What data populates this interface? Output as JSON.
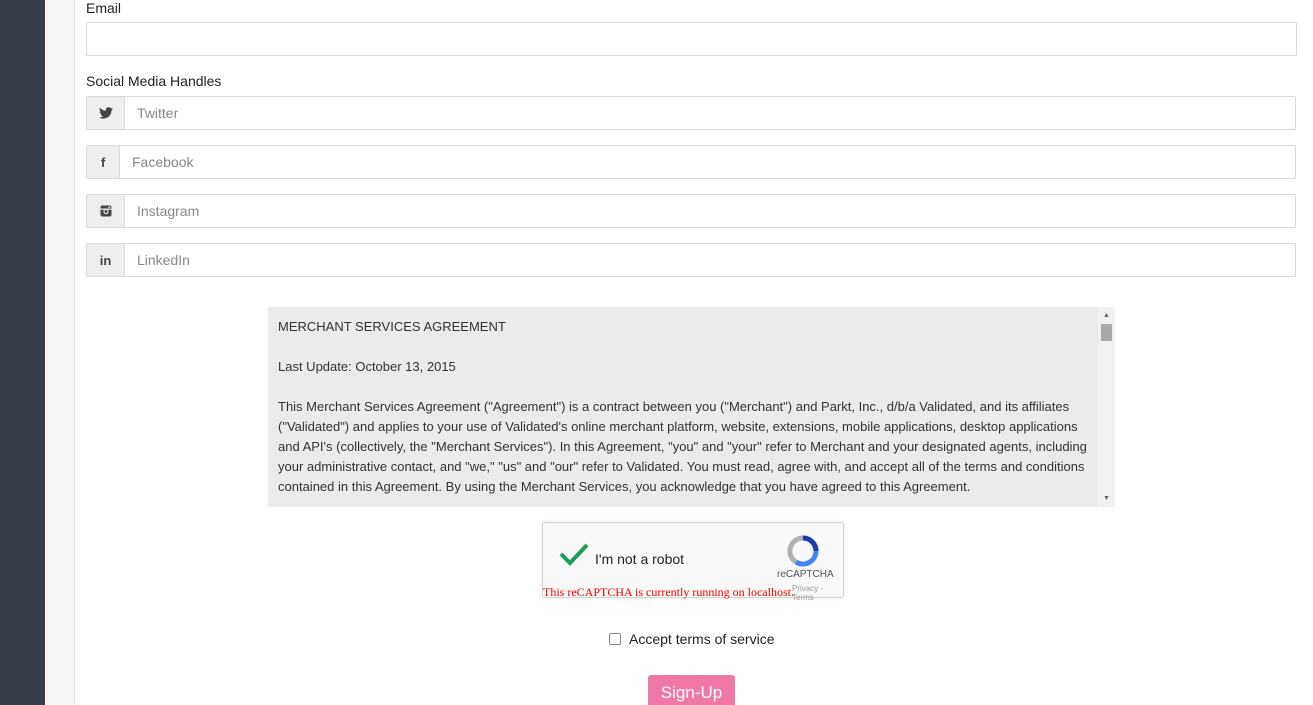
{
  "form": {
    "email_label": "Email",
    "email_value": "",
    "social_label": "Social Media Handles",
    "social": [
      {
        "icon": "twitter-icon",
        "glyph": "🐦",
        "placeholder": "Twitter"
      },
      {
        "icon": "facebook-icon",
        "glyph": "f",
        "placeholder": "Facebook"
      },
      {
        "icon": "instagram-icon",
        "glyph": "◙",
        "placeholder": "Instagram"
      },
      {
        "icon": "linkedin-icon",
        "glyph": "in",
        "placeholder": "LinkedIn"
      }
    ]
  },
  "agreement": {
    "title": "MERCHANT SERVICES AGREEMENT",
    "last_update": "Last Update: October 13, 2015",
    "body": "This Merchant Services Agreement (\"Agreement\") is a contract between you (\"Merchant\") and Parkt, Inc., d/b/a Validated, and its affiliates (\"Validated\") and applies to your use of Validated's online merchant platform, website, extensions, mobile applications, desktop applications and API's (collectively, the \"Merchant Services\"). In this Agreement, \"you\" and \"your\" refer to Merchant and your designated agents, including your administrative contact, and \"we,\" \"us\" and \"our\" refer to Validated. You must read, agree with, and accept all of the terms and conditions contained in this Agreement. By using the Merchant Services, you acknowledge that you have agreed to this Agreement."
  },
  "recaptcha": {
    "label": "I'm not a robot",
    "brand": "reCAPTCHA",
    "terms": "Privacy - Terms",
    "warning": "This reCAPTCHA is currently running on localhost."
  },
  "terms": {
    "label": "Accept terms of service",
    "checked": false
  },
  "signup": {
    "label": "Sign-Up"
  },
  "colors": {
    "sidebar": "#373d49",
    "signup": "#ef78a6",
    "check": "#1a9d5b"
  }
}
